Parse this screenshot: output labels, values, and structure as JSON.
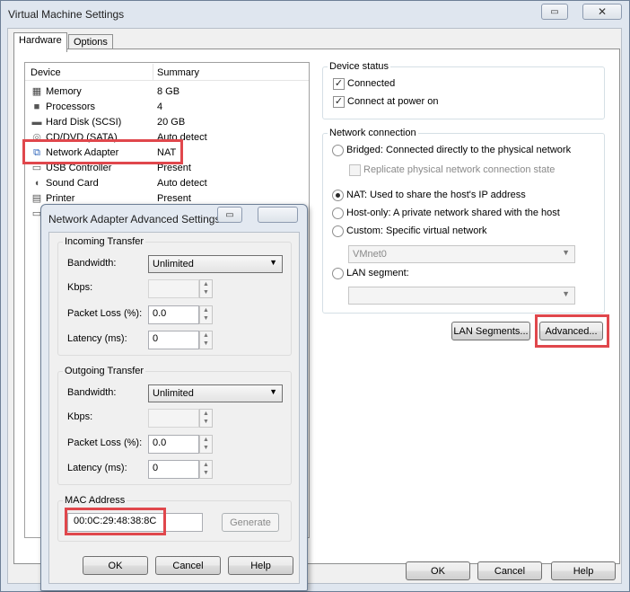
{
  "main_window": {
    "title": "Virtual Machine Settings",
    "tabs": [
      {
        "label": "Hardware"
      },
      {
        "label": "Options"
      }
    ],
    "device_list": {
      "headers": {
        "device": "Device",
        "summary": "Summary"
      },
      "rows": [
        {
          "device": "Memory",
          "summary": "8 GB",
          "icon": "memory-icon"
        },
        {
          "device": "Processors",
          "summary": "4",
          "icon": "processor-icon"
        },
        {
          "device": "Hard Disk (SCSI)",
          "summary": "20 GB",
          "icon": "hard-disk-icon"
        },
        {
          "device": "CD/DVD (SATA)",
          "summary": "Auto detect",
          "icon": "cd-dvd-icon"
        },
        {
          "device": "Network Adapter",
          "summary": "NAT",
          "icon": "network-adapter-icon",
          "selected": true
        },
        {
          "device": "USB Controller",
          "summary": "Present",
          "icon": "usb-icon"
        },
        {
          "device": "Sound Card",
          "summary": "Auto detect",
          "icon": "sound-card-icon"
        },
        {
          "device": "Printer",
          "summary": "Present",
          "icon": "printer-icon"
        }
      ]
    },
    "device_status": {
      "title": "Device status",
      "connected": {
        "label": "Connected",
        "checked": true
      },
      "connect_at_power_on": {
        "label": "Connect at power on",
        "checked": true
      }
    },
    "network_connection": {
      "title": "Network connection",
      "bridged": {
        "label": "Bridged: Connected directly to the physical network",
        "selected": false
      },
      "replicate": {
        "label": "Replicate physical network connection state",
        "checked": false
      },
      "nat": {
        "label": "NAT: Used to share the host's IP address",
        "selected": true
      },
      "host_only": {
        "label": "Host-only: A private network shared with the host",
        "selected": false
      },
      "custom": {
        "label": "Custom: Specific virtual network",
        "selected": false
      },
      "custom_value": "VMnet0",
      "lan_segment": {
        "label": "LAN segment:",
        "selected": false
      },
      "lan_segment_value": ""
    },
    "buttons": {
      "lan_segments": "LAN Segments...",
      "advanced": "Advanced...",
      "ok": "OK",
      "cancel": "Cancel",
      "help": "Help"
    }
  },
  "advanced_dialog": {
    "title": "Network Adapter Advanced Settings",
    "incoming": {
      "title": "Incoming Transfer",
      "bandwidth_label": "Bandwidth:",
      "bandwidth_value": "Unlimited",
      "kbps_label": "Kbps:",
      "kbps_value": "",
      "packet_loss_label": "Packet Loss (%):",
      "packet_loss_value": "0.0",
      "latency_label": "Latency (ms):",
      "latency_value": "0"
    },
    "outgoing": {
      "title": "Outgoing Transfer",
      "bandwidth_label": "Bandwidth:",
      "bandwidth_value": "Unlimited",
      "kbps_label": "Kbps:",
      "kbps_value": "",
      "packet_loss_label": "Packet Loss (%):",
      "packet_loss_value": "0.0",
      "latency_label": "Latency (ms):",
      "latency_value": "0"
    },
    "mac": {
      "title": "MAC Address",
      "value": "00:0C:29:48:38:8C",
      "generate_label": "Generate"
    },
    "buttons": {
      "ok": "OK",
      "cancel": "Cancel",
      "help": "Help"
    }
  },
  "highlight_color": "#e0474c"
}
